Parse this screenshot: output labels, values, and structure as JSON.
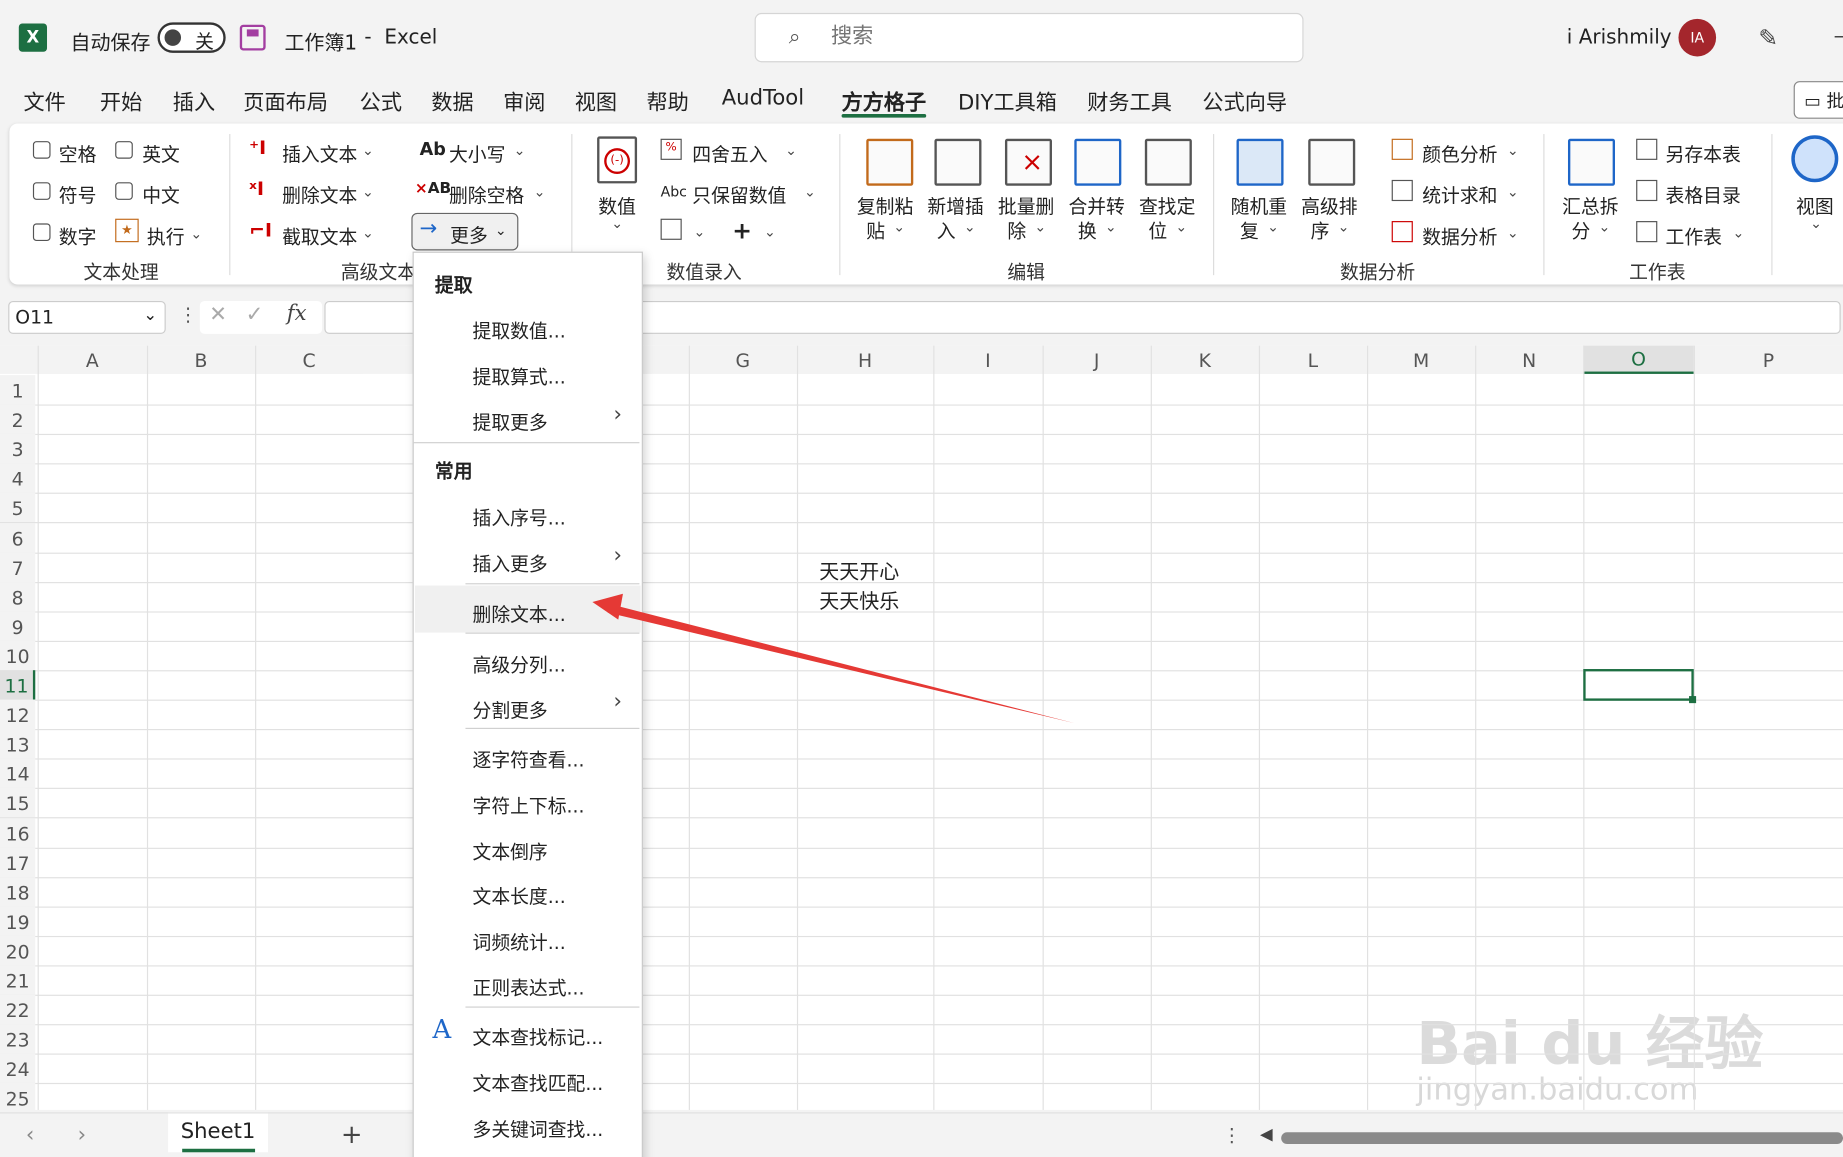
{
  "titlebar": {
    "autosave_label": "自动保存",
    "autosave_state": "关",
    "doc_name": "工作簿1",
    "separator": "-",
    "app_name": "Excel",
    "search_placeholder": "搜索",
    "user_name": "i Arishmily",
    "user_initials": "IA"
  },
  "tabs": [
    "文件",
    "开始",
    "插入",
    "页面布局",
    "公式",
    "数据",
    "审阅",
    "视图",
    "帮助",
    "AudTool",
    "方方格子",
    "DIY工具箱",
    "财务工具",
    "公式向导"
  ],
  "ribbon": {
    "text_group": {
      "items": [
        "空格",
        "英文",
        "符号",
        "中文",
        "数字",
        "执行"
      ],
      "label": "文本处理"
    },
    "advanced_group": {
      "items": [
        "插入文本",
        "删除文本",
        "截取文本"
      ],
      "label": "高级文本"
    },
    "case_group": {
      "items": [
        "大小写",
        "删除空格",
        "更多"
      ],
      "case_icon": "Ab",
      "space_icon": "AB"
    },
    "numeric_group": {
      "big_label": "数值",
      "items": [
        "四舍五入",
        "只保留数值"
      ],
      "label": "数值录入",
      "abc": "Abc"
    },
    "edit_group": {
      "items": [
        [
          "复制粘",
          "贴"
        ],
        [
          "新增插",
          "入"
        ],
        [
          "批量删",
          "除"
        ],
        [
          "合并转",
          "换"
        ],
        [
          "查找定",
          "位"
        ]
      ],
      "label": "编辑"
    },
    "analysis_group": {
      "items": [
        [
          "随机重",
          "复"
        ],
        [
          "高级排",
          "序"
        ]
      ],
      "side": [
        "颜色分析",
        "统计求和",
        "数据分析"
      ],
      "label": "数据分析"
    },
    "sheet_group": {
      "big": [
        "汇总拆",
        "分"
      ],
      "side": [
        "另存本表",
        "表格目录",
        "工作表"
      ],
      "label": "工作表"
    },
    "view_group": {
      "label": "视图"
    }
  },
  "formula_bar": {
    "name_box": "O11",
    "fx": "fx"
  },
  "columns": [
    "A",
    "B",
    "C",
    "G",
    "H",
    "I",
    "J",
    "K",
    "L",
    "M",
    "N",
    "O",
    "P"
  ],
  "rows": [
    "1",
    "2",
    "3",
    "4",
    "5",
    "6",
    "7",
    "8",
    "9",
    "10",
    "11",
    "12",
    "13",
    "14",
    "15",
    "16",
    "17",
    "18",
    "19",
    "20",
    "21",
    "22",
    "23",
    "24",
    "25"
  ],
  "cells": {
    "H7": "天天开心",
    "H8": "天天快乐"
  },
  "sheet": {
    "name": "Sheet1",
    "add": "+"
  },
  "dropdown": {
    "head1": "提取",
    "g1": [
      "提取数值...",
      "提取算式...",
      "提取更多"
    ],
    "head2": "常用",
    "g2": [
      "插入序号...",
      "插入更多"
    ],
    "g3": [
      "删除文本..."
    ],
    "g4": [
      "高级分列...",
      "分割更多"
    ],
    "g5": [
      "逐字符查看...",
      "字符上下标...",
      "文本倒序",
      "文本长度...",
      "词频统计...",
      "正则表达式..."
    ],
    "g6": [
      "文本查找标记...",
      "文本查找匹配...",
      "多关键词查找..."
    ]
  },
  "watermark": {
    "brand": "Bai du 经验",
    "url": "jingyan.baidu.com"
  },
  "colors": {
    "excel_green": "#1d6f42",
    "annotation_arrow": "#e53935",
    "avatar": "#a4262c"
  }
}
